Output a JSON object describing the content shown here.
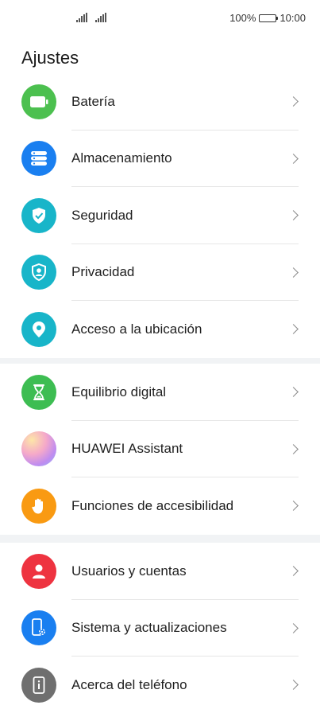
{
  "status_bar": {
    "battery_percent": "100%",
    "time": "10:00"
  },
  "header": {
    "title": "Ajustes"
  },
  "groups": [
    {
      "items": [
        {
          "label": "Batería",
          "icon": "battery-icon",
          "color": "#4cc04f"
        },
        {
          "label": "Almacenamiento",
          "icon": "storage-icon",
          "color": "#1a7ff0"
        },
        {
          "label": "Seguridad",
          "icon": "shield-check-icon",
          "color": "#18b5c9"
        },
        {
          "label": "Privacidad",
          "icon": "shield-person-icon",
          "color": "#18b5c9"
        },
        {
          "label": "Acceso a la ubicación",
          "icon": "location-pin-icon",
          "color": "#18b5c9"
        }
      ]
    },
    {
      "items": [
        {
          "label": "Equilibrio digital",
          "icon": "hourglass-icon",
          "color": "#3dbd52"
        },
        {
          "label": "HUAWEI Assistant",
          "icon": "assistant-orb-icon",
          "color": "#f2a0c6"
        },
        {
          "label": "Funciones de accesibilidad",
          "icon": "hand-icon",
          "color": "#f99a12"
        }
      ]
    },
    {
      "items": [
        {
          "label": "Usuarios y cuentas",
          "icon": "user-icon",
          "color": "#ee3340"
        },
        {
          "label": "Sistema y actualizaciones",
          "icon": "phone-settings-icon",
          "color": "#1a7ff0"
        },
        {
          "label": "Acerca del teléfono",
          "icon": "info-phone-icon",
          "color": "#6f6f6f"
        }
      ]
    }
  ]
}
